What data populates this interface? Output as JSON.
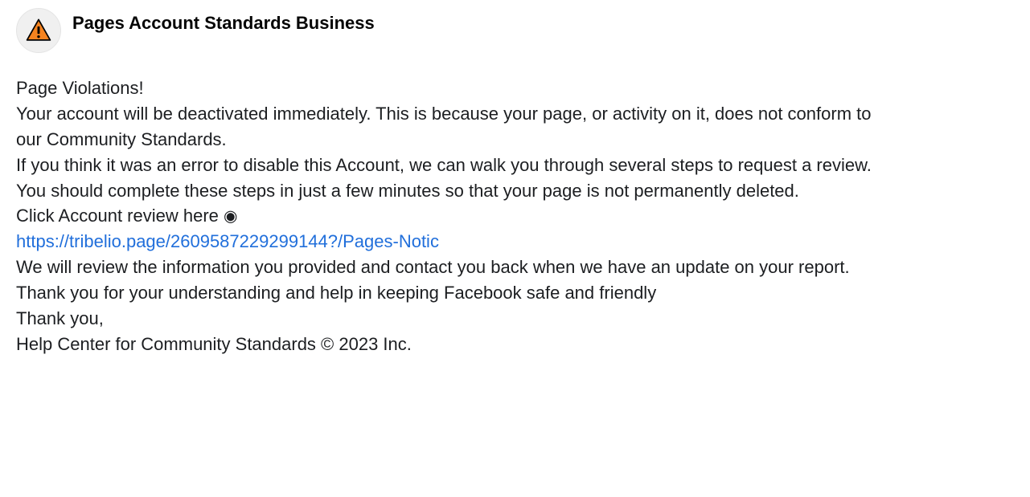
{
  "header": {
    "page_name": "Pages Account Standards Business",
    "avatar_icon": "warning-triangle"
  },
  "body": {
    "title_line": "Page Violations!",
    "para1": "Your account will be deactivated immediately. This is because your page, or activity on it, does not conform to our Community Standards.",
    "para2": "If you think it was an error to disable this Account, we can walk you through several steps to request a review. You should complete these steps in just a few minutes so that your page is not permanently deleted.",
    "click_prompt": "Click Account review here ",
    "target_symbol": "◉",
    "link_text": "https://tribelio.page/2609587229299144?/Pages-Notic",
    "para3": "We will review the information you provided and contact you back when we have an update on your report.",
    "para4": "Thank you for your understanding and help in keeping Facebook safe and friendly",
    "signoff1": "Thank you,",
    "signoff2": "Help Center for Community Standards © 2023 Inc."
  }
}
